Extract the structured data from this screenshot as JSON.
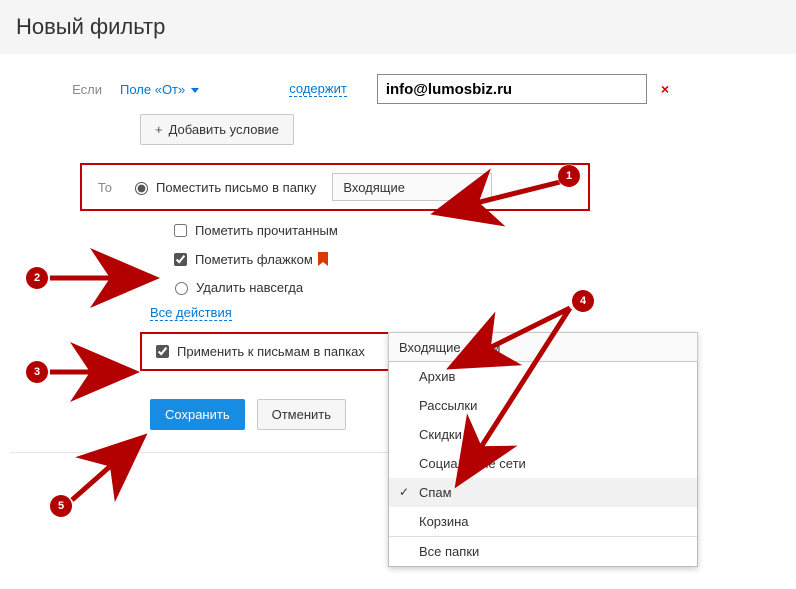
{
  "header": {
    "title": "Новый фильтр"
  },
  "cond": {
    "if_label": "Если",
    "field_label": "Поле «От»",
    "match_label": "содержит",
    "value": "info@lumosbiz.ru",
    "add_condition": "Добавить условие"
  },
  "action": {
    "then_label": "То",
    "move_to_folder": "Поместить письмо в папку",
    "folder_selected": "Входящие",
    "mark_read": "Пометить прочитанным",
    "mark_flag": "Пометить флажком",
    "delete_forever": "Удалить навсегда",
    "all_actions": "Все действия"
  },
  "apply": {
    "label": "Применить к письмам в папках",
    "selected_text": "Входящие, Спам",
    "options": {
      "archive": "Архив",
      "newsletters": "Рассылки",
      "discounts": "Скидки",
      "social": "Социальные сети",
      "spam": "Спам",
      "trash": "Корзина",
      "all": "Все папки"
    }
  },
  "buttons": {
    "save": "Сохранить",
    "cancel": "Отменить"
  },
  "annotations": {
    "b1": "1",
    "b2": "2",
    "b3": "3",
    "b4": "4",
    "b5": "5"
  }
}
